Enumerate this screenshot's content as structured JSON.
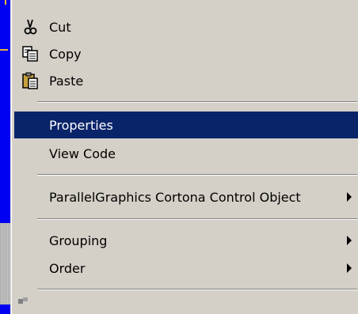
{
  "menu": {
    "items": [
      {
        "key": "cut",
        "label": "Cut",
        "icon": "scissors-icon"
      },
      {
        "key": "copy",
        "label": "Copy",
        "icon": "copy-icon"
      },
      {
        "key": "paste",
        "label": "Paste",
        "icon": "paste-icon"
      },
      {
        "key": "properties",
        "label": "Properties",
        "selected": true
      },
      {
        "key": "view_code",
        "label": "View Code"
      },
      {
        "key": "cortona",
        "label": "ParallelGraphics Cortona Control Object",
        "submenu": true
      },
      {
        "key": "grouping",
        "label": "Grouping",
        "submenu": true
      },
      {
        "key": "order",
        "label": "Order",
        "submenu": true
      }
    ]
  },
  "colors": {
    "menu_bg": "#d4d0c8",
    "selection_bg": "#0a246a",
    "selection_text": "#ffffff",
    "desktop_blue": "#0000f2"
  }
}
